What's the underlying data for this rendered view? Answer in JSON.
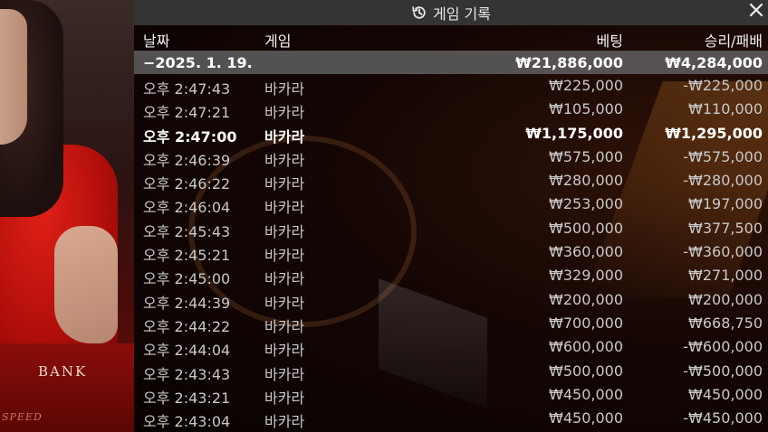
{
  "header": {
    "title": "게임 기록"
  },
  "columns": {
    "date": "날짜",
    "game": "게임",
    "bet": "베팅",
    "result": "승리/패배"
  },
  "summary": {
    "date": "−2025. 1. 19.",
    "bet": "₩21,886,000",
    "result": "₩4,284,000"
  },
  "background": {
    "bank_label": "BANK",
    "speed_label": "SPEED"
  },
  "rows": [
    {
      "time": "오후 2:47:43",
      "game": "바카라",
      "bet": "₩225,000",
      "result": "-₩225,000",
      "highlight": false
    },
    {
      "time": "오후 2:47:21",
      "game": "바카라",
      "bet": "₩105,000",
      "result": "₩110,000",
      "highlight": false
    },
    {
      "time": "오후 2:47:00",
      "game": "바카라",
      "bet": "₩1,175,000",
      "result": "₩1,295,000",
      "highlight": true
    },
    {
      "time": "오후 2:46:39",
      "game": "바카라",
      "bet": "₩575,000",
      "result": "-₩575,000",
      "highlight": false
    },
    {
      "time": "오후 2:46:22",
      "game": "바카라",
      "bet": "₩280,000",
      "result": "-₩280,000",
      "highlight": false
    },
    {
      "time": "오후 2:46:04",
      "game": "바카라",
      "bet": "₩253,000",
      "result": "₩197,000",
      "highlight": false
    },
    {
      "time": "오후 2:45:43",
      "game": "바카라",
      "bet": "₩500,000",
      "result": "₩377,500",
      "highlight": false
    },
    {
      "time": "오후 2:45:21",
      "game": "바카라",
      "bet": "₩360,000",
      "result": "-₩360,000",
      "highlight": false
    },
    {
      "time": "오후 2:45:00",
      "game": "바카라",
      "bet": "₩329,000",
      "result": "₩271,000",
      "highlight": false
    },
    {
      "time": "오후 2:44:39",
      "game": "바카라",
      "bet": "₩200,000",
      "result": "₩200,000",
      "highlight": false
    },
    {
      "time": "오후 2:44:22",
      "game": "바카라",
      "bet": "₩700,000",
      "result": "₩668,750",
      "highlight": false
    },
    {
      "time": "오후 2:44:04",
      "game": "바카라",
      "bet": "₩600,000",
      "result": "-₩600,000",
      "highlight": false
    },
    {
      "time": "오후 2:43:43",
      "game": "바카라",
      "bet": "₩500,000",
      "result": "-₩500,000",
      "highlight": false
    },
    {
      "time": "오후 2:43:21",
      "game": "바카라",
      "bet": "₩450,000",
      "result": "₩450,000",
      "highlight": false
    },
    {
      "time": "오후 2:43:04",
      "game": "바카라",
      "bet": "₩450,000",
      "result": "-₩450,000",
      "highlight": false
    }
  ],
  "icons": {
    "history": "history-icon",
    "close": "close-icon"
  }
}
